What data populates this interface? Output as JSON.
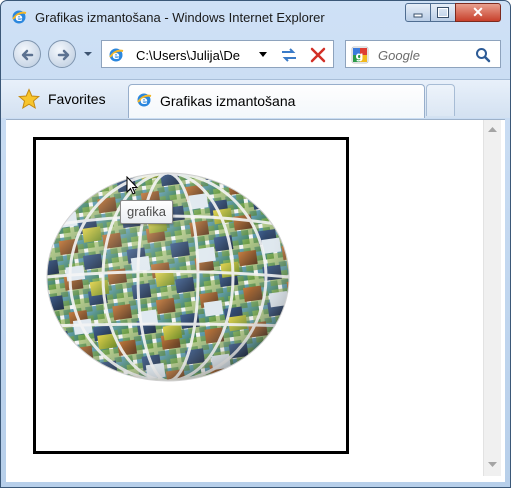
{
  "window": {
    "title": "Grafikas izmantošana - Windows Internet Explorer",
    "close_glyph": "✕"
  },
  "navigation": {
    "address": "C:\\Users\\Julija\\De",
    "search_placeholder": "Google"
  },
  "favorites_bar": {
    "favorites_label": "Favorites",
    "tab_label": "Grafikas izmantošana"
  },
  "page": {
    "tooltip": "grafika"
  },
  "colors": {
    "titlebar_top": "#cfe1f6",
    "close_button": "#c8402b",
    "ie_blue": "#1e78d6",
    "frame_border": "#000000"
  },
  "icons": [
    "ie-logo-icon",
    "back-arrow-icon",
    "forward-arrow-icon",
    "refresh-icon",
    "stop-icon",
    "google-icon",
    "search-icon",
    "star-icon",
    "cursor-icon"
  ]
}
